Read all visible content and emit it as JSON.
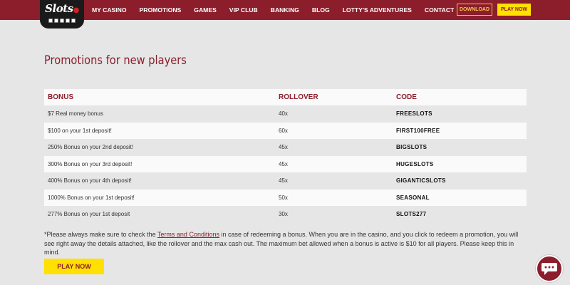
{
  "header": {
    "logo": {
      "text": "Slots",
      "icon": "cherry-icon"
    },
    "nav": [
      {
        "label": "MY CASINO"
      },
      {
        "label": "PROMOTIONS"
      },
      {
        "label": "GAMES"
      },
      {
        "label": "VIP CLUB"
      },
      {
        "label": "BANKING"
      },
      {
        "label": "BLOG"
      },
      {
        "label": "LOTTY'S ADVENTURES"
      },
      {
        "label": "CONTACT"
      }
    ],
    "download_label": "DOWNLOAD",
    "play_label": "PLAY NOW"
  },
  "main": {
    "title": "Promotions for new players",
    "table": {
      "headers": [
        "BONUS",
        "ROLLOVER",
        "CODE"
      ],
      "rows": [
        {
          "bonus": "$7 Real money bonus",
          "rollover": "40x",
          "code": "FREESLOTS"
        },
        {
          "bonus": "$100 on your 1st deposit!",
          "rollover": "60x",
          "code": "FIRST100FREE"
        },
        {
          "bonus": "250% Bonus on your 2nd deposit!",
          "rollover": "45x",
          "code": "BIGSLOTS"
        },
        {
          "bonus": "300% Bonus on your 3rd deposit!",
          "rollover": "45x",
          "code": "HUGESLOTS"
        },
        {
          "bonus": "400% Bonus on your 4th deposit!",
          "rollover": "45x",
          "code": "GIGANTICSLOTS"
        },
        {
          "bonus": "1000% Bonus on your 1st deposit!",
          "rollover": "50x",
          "code": "SEASONAL"
        },
        {
          "bonus": "277% Bonus on your 1st deposit",
          "rollover": "30x",
          "code": "SLOTS277"
        }
      ]
    },
    "footnote": {
      "before": "*Please always make sure to check the ",
      "link": "Terms and Conditions",
      "after": " in case of redeeming a bonus. When you are in the casino, and you click to redeem a promotion, you will see right away the details attached, like the rollover and the max cash out. The maximum bet allowed when a bonus is active is $10 for all players. Please keep this in mind."
    },
    "play_label": "PLAY NOW"
  },
  "chat": {
    "icon": "chat-bubble-icon"
  },
  "colors": {
    "brand": "#8c1d2b",
    "accent": "#ffe000",
    "outline": "#f3c84b",
    "page_bg": "#e6e6e6"
  }
}
